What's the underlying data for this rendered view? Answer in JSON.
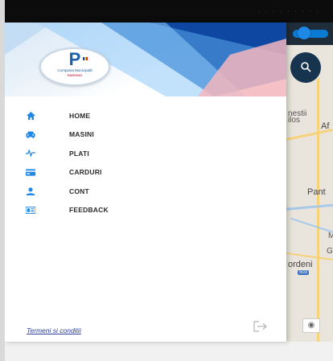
{
  "app": {
    "logo_letter": "P",
    "logo_line1": "Compania Municipală",
    "logo_line2": "PARKING"
  },
  "menu": {
    "items": [
      {
        "label": "HOME",
        "icon": "home-icon"
      },
      {
        "label": "MASINI",
        "icon": "car-icon"
      },
      {
        "label": "PLATI",
        "icon": "activity-icon"
      },
      {
        "label": "CARDURI",
        "icon": "credit-card-icon"
      },
      {
        "label": "CONT",
        "icon": "account-icon"
      },
      {
        "label": "FEEDBACK",
        "icon": "feedback-icon"
      }
    ]
  },
  "footer": {
    "terms_label": "Termeni si conditii",
    "logout_icon": "logout-icon"
  },
  "map": {
    "labels": [
      "nestii",
      "ilos",
      "Af",
      "Pant",
      "M",
      "Gl",
      "ordeni"
    ],
    "road_shield": "503"
  },
  "colors": {
    "accent": "#1a5fa8",
    "icon": "#1e88e5",
    "header_blue": "#0d47a1",
    "header_pink": "#e8a0a8",
    "map_topbar": "#1f2c3a"
  }
}
